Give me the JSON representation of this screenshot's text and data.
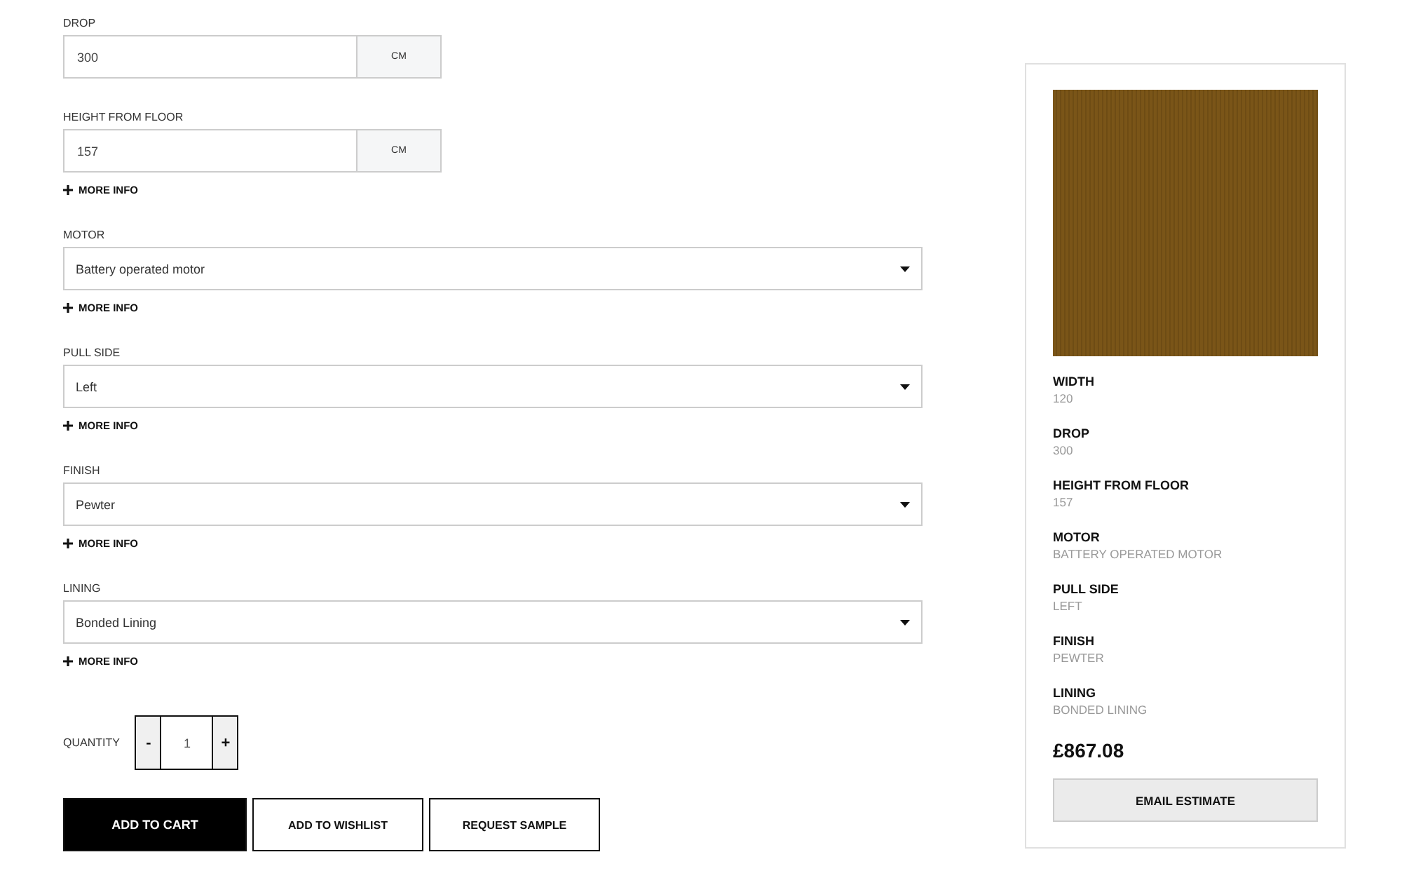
{
  "fields": [
    {
      "kind": "measure",
      "label": "DROP",
      "value": "300",
      "unit": "CM"
    },
    {
      "kind": "measure",
      "label": "HEIGHT FROM FLOOR",
      "value": "157",
      "unit": "CM",
      "more_info": "MORE INFO"
    },
    {
      "kind": "select",
      "label": "MOTOR",
      "value": "Battery operated motor",
      "more_info": "MORE INFO"
    },
    {
      "kind": "select",
      "label": "PULL SIDE",
      "value": "Left",
      "more_info": "MORE INFO"
    },
    {
      "kind": "select",
      "label": "FINISH",
      "value": "Pewter",
      "more_info": "MORE INFO"
    },
    {
      "kind": "select",
      "label": "LINING",
      "value": "Bonded Lining",
      "more_info": "MORE INFO"
    }
  ],
  "quantity": {
    "label": "QUANTITY",
    "minus": "-",
    "value": "1",
    "plus": "+"
  },
  "buttons": [
    {
      "kind": "primary",
      "label": "ADD TO CART"
    },
    {
      "kind": "outline",
      "label": "ADD TO WISHLIST"
    },
    {
      "kind": "outline",
      "label": "REQUEST SAMPLE"
    }
  ],
  "summary": {
    "specs": [
      {
        "label": "WIDTH",
        "value": "120"
      },
      {
        "label": "DROP",
        "value": "300"
      },
      {
        "label": "HEIGHT FROM FLOOR",
        "value": "157"
      },
      {
        "label": "MOTOR",
        "value": "BATTERY OPERATED MOTOR"
      },
      {
        "label": "PULL SIDE",
        "value": "LEFT"
      },
      {
        "label": "FINISH",
        "value": "PEWTER"
      },
      {
        "label": "LINING",
        "value": "BONDED LINING"
      }
    ],
    "price": "£867.08",
    "button": "EMAIL ESTIMATE"
  }
}
